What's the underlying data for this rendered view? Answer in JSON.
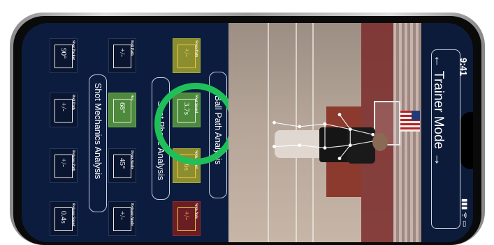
{
  "status_bar": {
    "time": "9:41",
    "signal": "▮▮▮ ᯤ ▭"
  },
  "header": {
    "title": "← Trainer Mode →"
  },
  "sections": {
    "shot_mechanics": "Shot Mechanics Analysis",
    "shot_phase": "Shot Phase Analysis",
    "ball_path": "Ball Path Analysis"
  },
  "metrics": [
    {
      "label": "Shot Pocket",
      "value": "90°"
    },
    {
      "label": "Ball Path",
      "value": "+/-"
    },
    {
      "label": "Release Path",
      "value": "+/-"
    },
    {
      "label": "Release Speed",
      "value": "0.4s"
    },
    {
      "label": "Ball Path",
      "value": "+/-"
    },
    {
      "label": "Arc",
      "value": "68°"
    },
    {
      "label": "Drop Angle",
      "value": "45°"
    },
    {
      "label": "Release Angle",
      "value": "+/-"
    },
    {
      "label": "Snap Path",
      "value": "+/-"
    },
    {
      "label": "Shot Speed",
      "value": "3.7s"
    },
    {
      "label": "Spin Speed",
      "value": "0.6s"
    },
    {
      "label": "Spin Axis",
      "value": "+/-"
    }
  ],
  "colors": {
    "panel": "#0c1c3e",
    "green": "#4e8a3c",
    "olive": "#8a8e2e",
    "maroon": "#6a1e24",
    "highlight_ring": "#1fc05a"
  }
}
